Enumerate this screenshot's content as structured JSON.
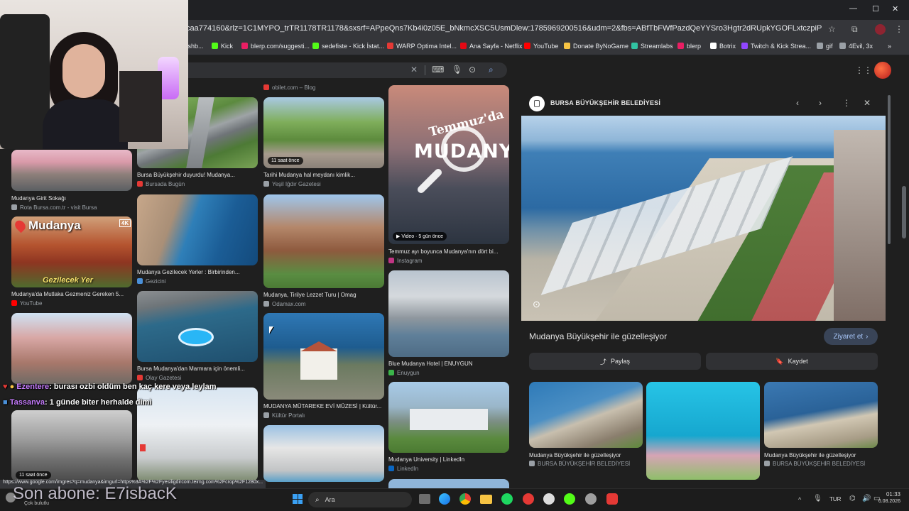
{
  "browser": {
    "url": "caa774160&rlz=1C1MYPO_trTR1178TR1178&sxsrf=APpeQns7Kb4i0z05E_bNkmcXSC5UsmDlew:1785969200516&udm=2&fbs=ABfTbFWfPazdQeYYSro3Hgtr2dRUpkYGOFLxtczpiPPMonK6bxzDiCFsgARVFi5PA_rffFdPT...",
    "status_url": "https://www.google.com/imgres?q=mudanya&imgurl=https%3A%2F%2Fyesiligdircom.teimg.com%2Fcrop%2F1280x...",
    "window_controls": {
      "minimize": "—",
      "maximize": "☐",
      "close": "✕"
    },
    "bookmarks": [
      {
        "label": "Dashb...",
        "color": "#4caf50"
      },
      {
        "label": "Kick",
        "color": "#53fc18"
      },
      {
        "label": "blerp.com/suggesti...",
        "color": "#e91e63"
      },
      {
        "label": "sedefiste - Kick İstat...",
        "color": "#53fc18"
      },
      {
        "label": "WARP Optima Intel...",
        "color": "#e53935"
      },
      {
        "label": "Ana Sayfa - Netflix",
        "color": "#e50914"
      },
      {
        "label": "YouTube",
        "color": "#ff0000"
      },
      {
        "label": "Donate ByNoGame",
        "color": "#f6c343"
      },
      {
        "label": "Streamlabs",
        "color": "#31c3a2"
      },
      {
        "label": "blerp",
        "color": "#e91e63"
      },
      {
        "label": "Botrix",
        "color": "#ffffff"
      },
      {
        "label": "Twitch & Kick Strea...",
        "color": "#9146ff"
      },
      {
        "label": "gif",
        "color": "#9aa0a6"
      },
      {
        "label": "4Evil, 3x",
        "color": "#9aa0a6"
      }
    ]
  },
  "results": [
    {
      "id": "r1",
      "caption": "",
      "source": "obilet.com – Blog",
      "fav": "#e53935",
      "chip": ""
    },
    {
      "id": "r2",
      "caption": "Bursa Büyükşehir duyurdu! Mudanya...",
      "source": "Bursada Bugün",
      "fav": "#e53935",
      "chip": ""
    },
    {
      "id": "r3",
      "caption": "Tarihi Mudanya hal meydanı kimlik...",
      "source": "Yeşil Iğdır Gazetesi",
      "fav": "#9aa0a6",
      "chip": "11 saat önce"
    },
    {
      "id": "r4",
      "caption": "Temmuz ayı boyunca Mudanya'nın dört bi...",
      "source": "Instagram",
      "fav": "#c13584",
      "chip": "▶ Video · 5 gün önce"
    },
    {
      "id": "r5",
      "caption": "Mudanya Girit Sokağı",
      "source": "Rota Bursa.com.tr - visit Bursa",
      "fav": "#9aa0a6",
      "chip": ""
    },
    {
      "id": "r6",
      "caption": "Mudanya Gezilecek Yerler : Birbirinden...",
      "source": "Gezicini",
      "fav": "#4a90d9",
      "chip": ""
    },
    {
      "id": "r7",
      "caption": "Mudanya, Tirilye Lezzet Turu | Omag",
      "source": "Odamax.com",
      "fav": "#9aa0a6",
      "chip": ""
    },
    {
      "id": "r8",
      "caption": "Mudanya'da Mutlaka Gezmeniz Gereken 5...",
      "source": "YouTube",
      "fav": "#ff0000",
      "chip": ""
    },
    {
      "id": "r9",
      "caption": "Bursa Mudanya'dan Marmara için önemli...",
      "source": "Olay Gazetesi",
      "fav": "#e53935",
      "chip": ""
    },
    {
      "id": "r10",
      "caption": "Blue Mudanya Hotel | ENUYGUN",
      "source": "Enuygun",
      "fav": "#3bb54a",
      "chip": ""
    },
    {
      "id": "r11",
      "caption": "MUDANYA MÜTAREKE EVİ MÜZESİ | Kültür...",
      "source": "Kültür Portalı",
      "fav": "#9aa0a6",
      "chip": ""
    },
    {
      "id": "r12",
      "caption": "Mudanya University | LinkedIn",
      "source": "LinkedIn",
      "fav": "#0a66c2",
      "chip": ""
    },
    {
      "id": "r13",
      "caption": "",
      "source": "",
      "fav": "#9aa0a6",
      "chip": "11 saat önce"
    }
  ],
  "overlay_text": {
    "temmuz": "Temmuz'da",
    "mudanya_big": "MUDANYA",
    "mudanya_card": "Mudanya",
    "gezilecek": "Gezilecek Yer",
    "hd": "4K"
  },
  "panel": {
    "source_title": "BURSA BÜYÜKŞEHİR BELEDİYESİ",
    "heading": "Mudanya Büyükşehir ile güzelleşiyor",
    "visit_label": "Ziyaret et",
    "share_label": "Paylaş",
    "save_label": "Kaydet",
    "related": [
      {
        "caption": "Mudanya Büyükşehir ile güzelleşiyor",
        "source": "BURSA BÜYÜKŞEHİR BELEDİYESİ"
      },
      {
        "caption": "",
        "source": ""
      },
      {
        "caption": "Mudanya Büyükşehir ile güzelleşiyor",
        "source": "BURSA BÜYÜKŞEHİR BELEDİYESİ"
      }
    ]
  },
  "chat": [
    {
      "user": "Ezentere",
      "user_color": "#c77dff",
      "message": ": burası ozbi oldüm ben kaç kere veya leylam"
    },
    {
      "user": "Tassanva",
      "user_color": "#c77dff",
      "message": ": 1 günde biter herhalde dimi"
    }
  ],
  "sub_banner": "Son abone: E7isbacK",
  "taskbar": {
    "search_placeholder": "Ara",
    "weather": "Çok bulutlu",
    "lang": "TUR",
    "time": "01:33",
    "date": "6.08.2026"
  }
}
